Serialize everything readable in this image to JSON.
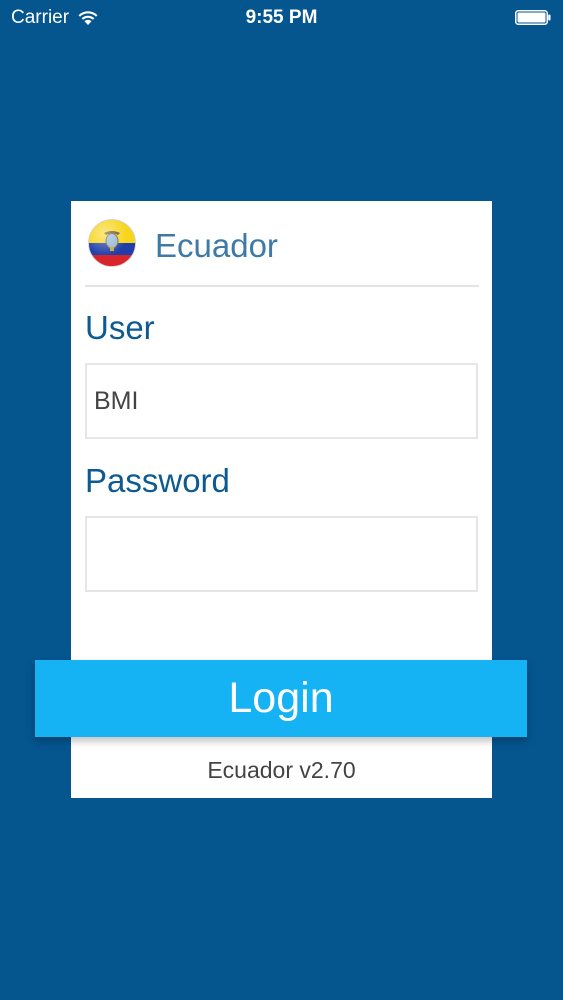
{
  "status_bar": {
    "carrier": "Carrier",
    "time": "9:55 PM",
    "icons": [
      "wifi-icon",
      "battery-icon"
    ]
  },
  "card": {
    "country": "Ecuador",
    "flag_icon": "ecuador-flag-icon",
    "user_label": "User",
    "user_value": "BMI",
    "password_label": "Password",
    "password_value": ""
  },
  "login": {
    "label": "Login"
  },
  "footer": {
    "version": "Ecuador v2.70"
  },
  "colors": {
    "background": "#05558f",
    "title": "#3f7aa6",
    "label": "#0d5a91",
    "button": "#16b3f4",
    "flag_yellow": "#f6d51a",
    "flag_blue": "#1f3ea8",
    "flag_red": "#d9242c"
  }
}
